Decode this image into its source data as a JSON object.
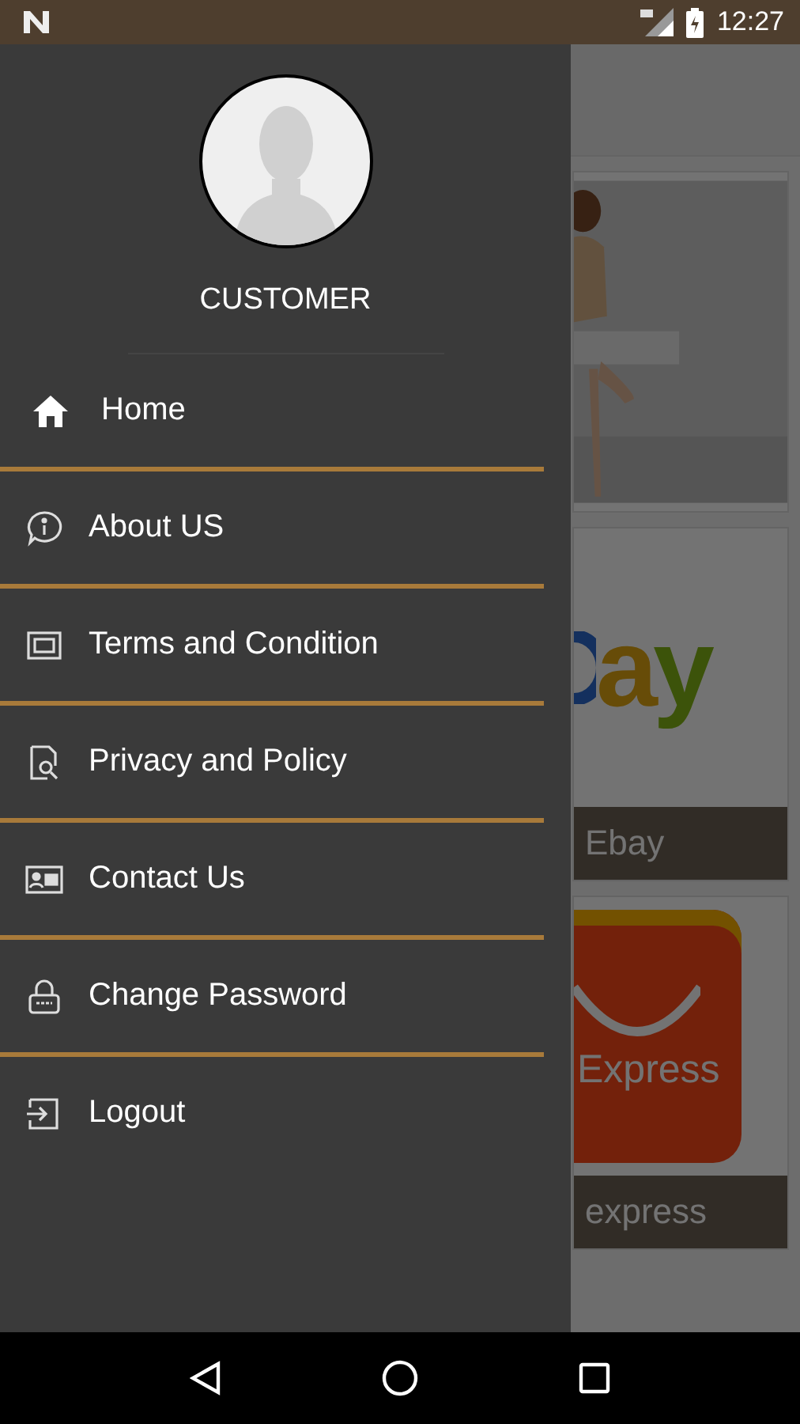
{
  "status_bar": {
    "time": "12:27"
  },
  "drawer": {
    "user_name": "CUSTOMER",
    "items": [
      {
        "kind": "home",
        "label": "Home"
      },
      {
        "kind": "info",
        "label": "About US"
      },
      {
        "kind": "terms",
        "label": "Terms and Condition"
      },
      {
        "kind": "privacy",
        "label": "Privacy and Policy"
      },
      {
        "kind": "contact",
        "label": "Contact Us"
      },
      {
        "kind": "password",
        "label": "Change Password"
      },
      {
        "kind": "logout",
        "label": "Logout"
      }
    ]
  },
  "background_cards": [
    {
      "kind": "banner"
    },
    {
      "kind": "ebay",
      "logo": [
        "a",
        "y"
      ],
      "caption": "Ebay"
    },
    {
      "kind": "aliexpress",
      "logo_text": "Express",
      "caption": "express"
    }
  ]
}
